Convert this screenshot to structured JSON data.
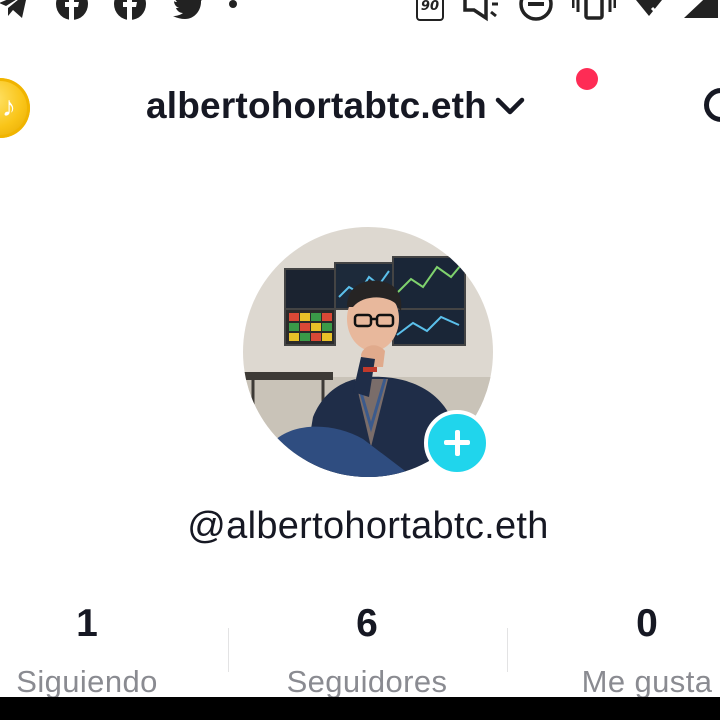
{
  "status_bar": {
    "icons": [
      "telegram-icon",
      "facebook-icon",
      "facebook-icon",
      "twitter-icon",
      "dot-icon",
      "refresh-rate-icon",
      "megaphone-icon",
      "do-not-disturb-icon",
      "vibrate-icon",
      "wifi-icon",
      "signal-icon"
    ],
    "refresh_rate": "90"
  },
  "header": {
    "account_name": "albertohortabtc.eth",
    "has_notification": true
  },
  "profile": {
    "username": "@albertohortabtc.eth"
  },
  "stats": [
    {
      "value": "1",
      "label": "Siguiendo"
    },
    {
      "value": "6",
      "label": "Seguidores"
    },
    {
      "value": "0",
      "label": "Me gusta"
    }
  ],
  "colors": {
    "accent_cyan": "#20d5ec",
    "notification_red": "#fe2c55",
    "coin_gold": "#f9c417",
    "text_primary": "#161823",
    "text_secondary": "#8a8b91"
  }
}
